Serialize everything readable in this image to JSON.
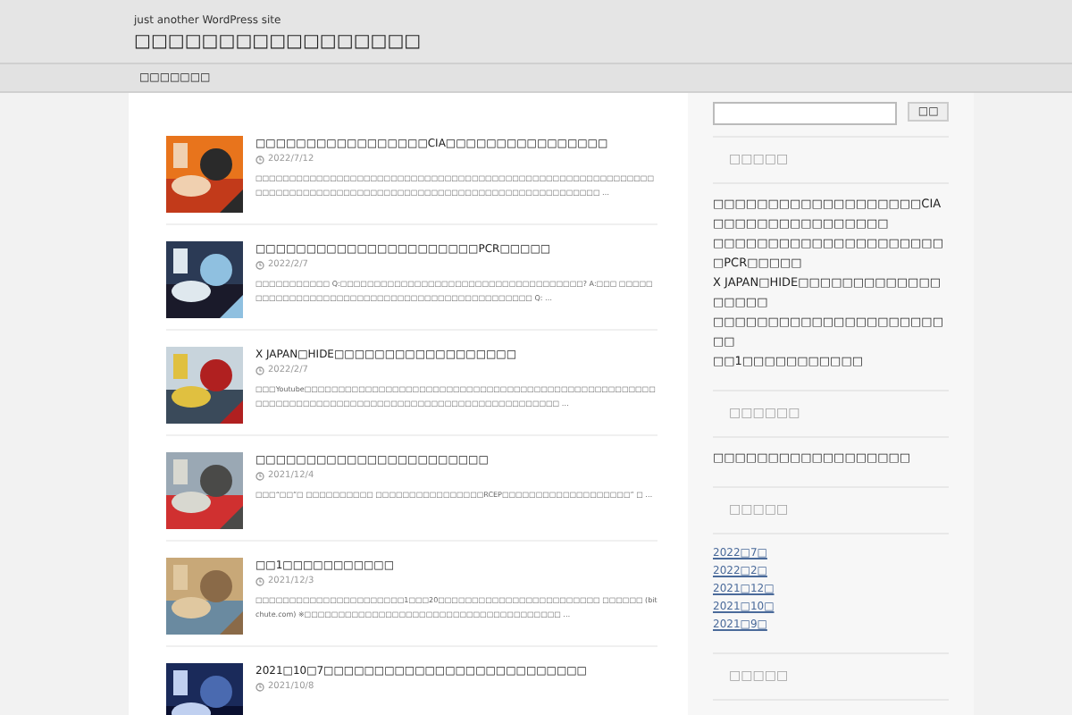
{
  "header": {
    "tagline": "just another WordPress site",
    "site_title": "□□□□□□□□□□□□□□□□□"
  },
  "nav": {
    "items": [
      {
        "label": "□□□□□□□"
      }
    ]
  },
  "posts": [
    {
      "title": "□□□□□□□□□□□□□□□□□CIA□□□□□□□□□□□□□□□□",
      "date": "2022/7/12",
      "excerpt": "□□□□□□□□□□□□□□□□□□□□□□□□□□□□□□□□□□□□□□□□□□□□□□□□□□□□□□□□□□□□□□□□□□□□□□□□□□□□□□□□□□□□□□□□□□□□□□□□□□□□□□□□□□□□□□ …"
    },
    {
      "title": "□□□□□□□□□□□□□□□□□□□□□□PCR□□□□□",
      "date": "2022/2/7",
      "excerpt": "□□□□□□□□□□□ Q:□□□□□□□□□□□□□□□□□□□□□□□□□□□□□□□□□□□□? A:□□□ □□□□□□□□□□□□□□□□□□□□□□□□□□□□□□□□□□□□□□□□□□□□□□ Q: …"
    },
    {
      "title": "X JAPAN□HIDE□□□□□□□□□□□□□□□□□□",
      "date": "2022/2/7",
      "excerpt": "□□□Youtube□□□□□□□□□□□□□□□□□□□□□□□□□□□□□□□□□□□□□□□□□□□□□□□□□□□□□□□□□□□□□□□□□□□□□□□□□□□□□□□□□□□□□□□□□□□□□□□□□ …"
    },
    {
      "title": "□□□□□□□□□□□□□□□□□□□□□□□",
      "date": "2021/12/4",
      "excerpt": "□□□“□□”□ □□□□□□□□□□ □□□□□□□□□□□□□□□□RCEP□□□□□□□□□□□□□□□□□□□” □ …"
    },
    {
      "title": "□□1□□□□□□□□□□□",
      "date": "2021/12/3",
      "excerpt": "□□□□□□□□□□□□□□□□□□□□□□1□□□20□□□□□□□□□□□□□□□□□□□□□□□□ □□□□□□ (bitchute.com) ※□□□□□□□□□□□□□□□□□□□□□□□□□□□□□□□□□□□□□□ …"
    },
    {
      "title": "2021□10□7□□□□□□□□□□□□□□□□□□□□□□□□□□",
      "date": "2021/10/8"
    }
  ],
  "search": {
    "button": "□□"
  },
  "widgets": [
    {
      "kind": "list",
      "heading": "□□□□□",
      "items": [
        "□□□□□□□□□□□□□□□□□□□CIA□□□□□□□□□□□□□□□□",
        "□□□□□□□□□□□□□□□□□□□□□□PCR□□□□□",
        "X JAPAN□HIDE□□□□□□□□□□□□□□□□□□",
        "□□□□□□□□□□□□□□□□□□□□□□□",
        "□□1□□□□□□□□□□□"
      ]
    },
    {
      "kind": "list",
      "heading": "□□□□□□",
      "items": [
        "□□□□□□□□□□□□□□□□□□"
      ]
    },
    {
      "kind": "links",
      "heading": "□□□□□",
      "items": [
        "2022□7□",
        "2022□2□",
        "2021□12□",
        "2021□10□",
        "2021□9□"
      ]
    },
    {
      "kind": "heading",
      "heading": "□□□□□"
    }
  ]
}
